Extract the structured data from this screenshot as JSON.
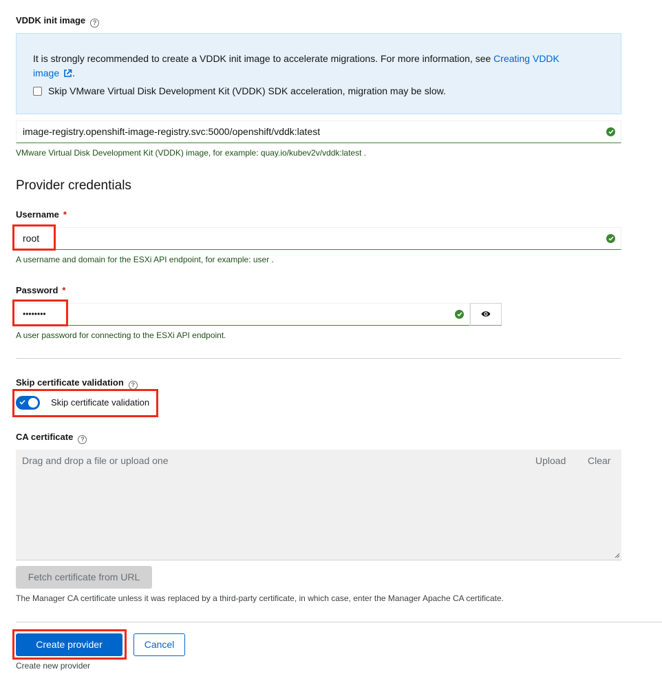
{
  "vddk": {
    "label": "VDDK init image",
    "info_text": "It is strongly recommended to create a VDDK init image to accelerate migrations. For more information, see ",
    "info_link_line1": "Creating VDDK",
    "info_link_line2": "image",
    "info_period": ".",
    "skip_checkbox_label": "Skip VMware Virtual Disk Development Kit (VDDK) SDK acceleration, migration may be slow.",
    "skip_checked": false,
    "image_value": "image-registry.openshift-image-registry.svc:5000/openshift/vddk:latest",
    "helper": "VMware Virtual Disk Development Kit (VDDK) image, for example: quay.io/kubev2v/vddk:latest ."
  },
  "credentials": {
    "title": "Provider credentials",
    "username_label": "Username",
    "required_mark": "*",
    "username_value": "root",
    "username_helper": "A username and domain for the ESXi API endpoint, for example: user .",
    "password_label": "Password",
    "password_value": "••••••••",
    "password_helper": "A user password for connecting to the ESXi API endpoint."
  },
  "certificate": {
    "skip_label": "Skip certificate validation",
    "skip_toggle_label": "Skip certificate validation",
    "skip_enabled": true,
    "ca_label": "CA certificate",
    "upload_placeholder": "Drag and drop a file or upload one",
    "upload_button": "Upload",
    "clear_button": "Clear",
    "fetch_button": "Fetch certificate from URL",
    "helper": "The Manager CA certificate unless it was replaced by a third-party certificate, in which case, enter the Manager Apache CA certificate."
  },
  "actions": {
    "create_label": "Create provider",
    "cancel_label": "Cancel",
    "helper": "Create new provider"
  },
  "colors": {
    "accent": "#0066cc",
    "success": "#3e8635",
    "highlight": "#ee2a1a"
  }
}
